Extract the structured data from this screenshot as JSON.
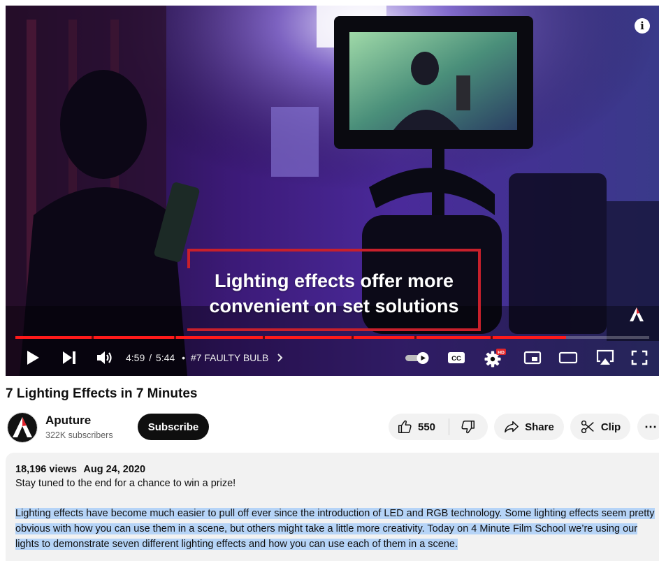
{
  "player": {
    "caption_lines": [
      "Lighting effects offer more",
      "convenient on set solutions"
    ],
    "info_icon": "i",
    "time_current": "4:59",
    "time_separator": "/",
    "time_total": "5:44",
    "chapter_bullet": "•",
    "chapter": "#7 FAULTY BULB",
    "progress_fraction": 0.869,
    "chapter_marks": [
      0.12,
      0.25,
      0.39,
      0.53,
      0.63,
      0.75
    ],
    "accent_color": "#ff1a1a",
    "caption_frame_color": "#c8202b",
    "cc_label": "CC",
    "hd_badge": "HD",
    "icons": [
      "play-icon",
      "next-icon",
      "volume-icon",
      "autoplay-toggle",
      "cc-icon",
      "settings-gear-icon",
      "miniplayer-icon",
      "theater-icon",
      "airplay-icon",
      "fullscreen-icon",
      "info-icon"
    ]
  },
  "video": {
    "title": "7 Lighting Effects in 7 Minutes"
  },
  "channel": {
    "name": "Aputure",
    "subscribers": "322K subscribers",
    "subscribe_label": "Subscribe"
  },
  "actions": {
    "like_count": "550",
    "share_label": "Share",
    "clip_label": "Clip",
    "more_label": "⋯"
  },
  "description": {
    "views": "18,196 views",
    "date": "Aug 24, 2020",
    "teaser": "Stay tuned to the end for a chance to win a prize!",
    "body": "Lighting effects have become much easier to pull off ever since the introduction of LED and RGB technology. Some lighting effects seem pretty obvious with how you can use them in a scene, but others might take a little more creativity. Today on 4 Minute Film School we’re using our lights to demonstrate seven different lighting effects and how you can use each of them in a scene.",
    "highlight_color": "#b6d4f7"
  }
}
